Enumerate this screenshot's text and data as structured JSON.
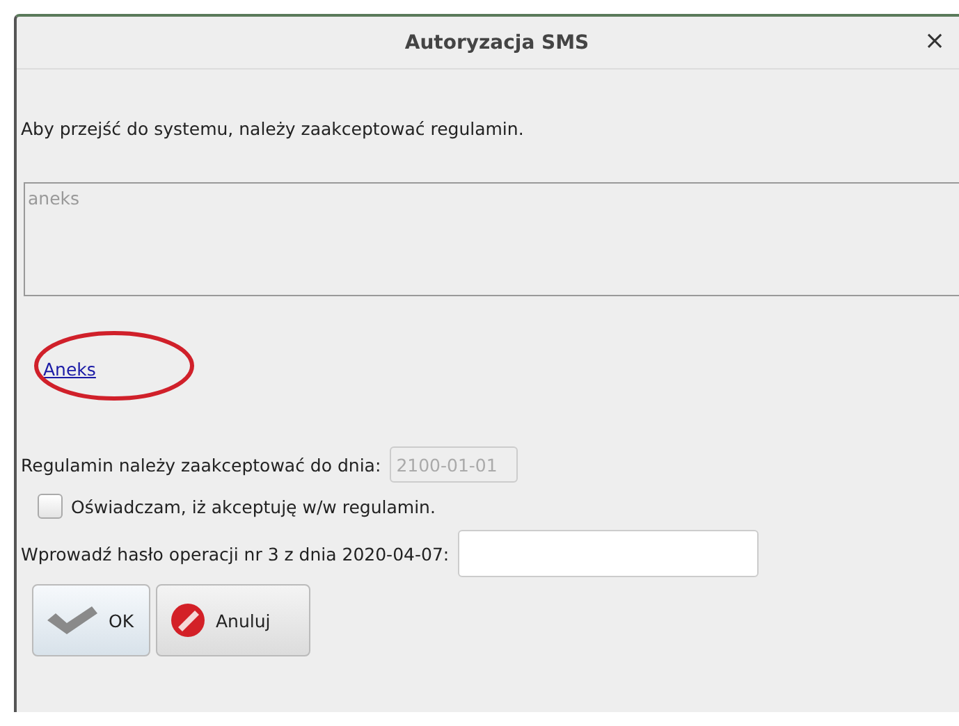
{
  "window": {
    "title": "Autoryzacja SMS",
    "close": "×"
  },
  "intro": "Aby przejść do systemu, należy zaakceptować regulamin.",
  "terms_box": {
    "value": "aneks",
    "disabled": true
  },
  "link": {
    "label": "Aneks",
    "circled": true
  },
  "deadline": {
    "label": "Regulamin należy zaakceptować do dnia:",
    "value": "2100-01-01",
    "disabled": true
  },
  "consent": {
    "label": "Oświadczam, iż akceptuję w/w regulamin.",
    "checked": false
  },
  "password": {
    "label": "Wprowadź hasło operacji nr 3 z dnia 2020-04-07:"
  },
  "buttons": [
    {
      "kind": "ok",
      "label": "OK"
    },
    {
      "kind": "cancel",
      "label": "Anuluj"
    }
  ]
}
